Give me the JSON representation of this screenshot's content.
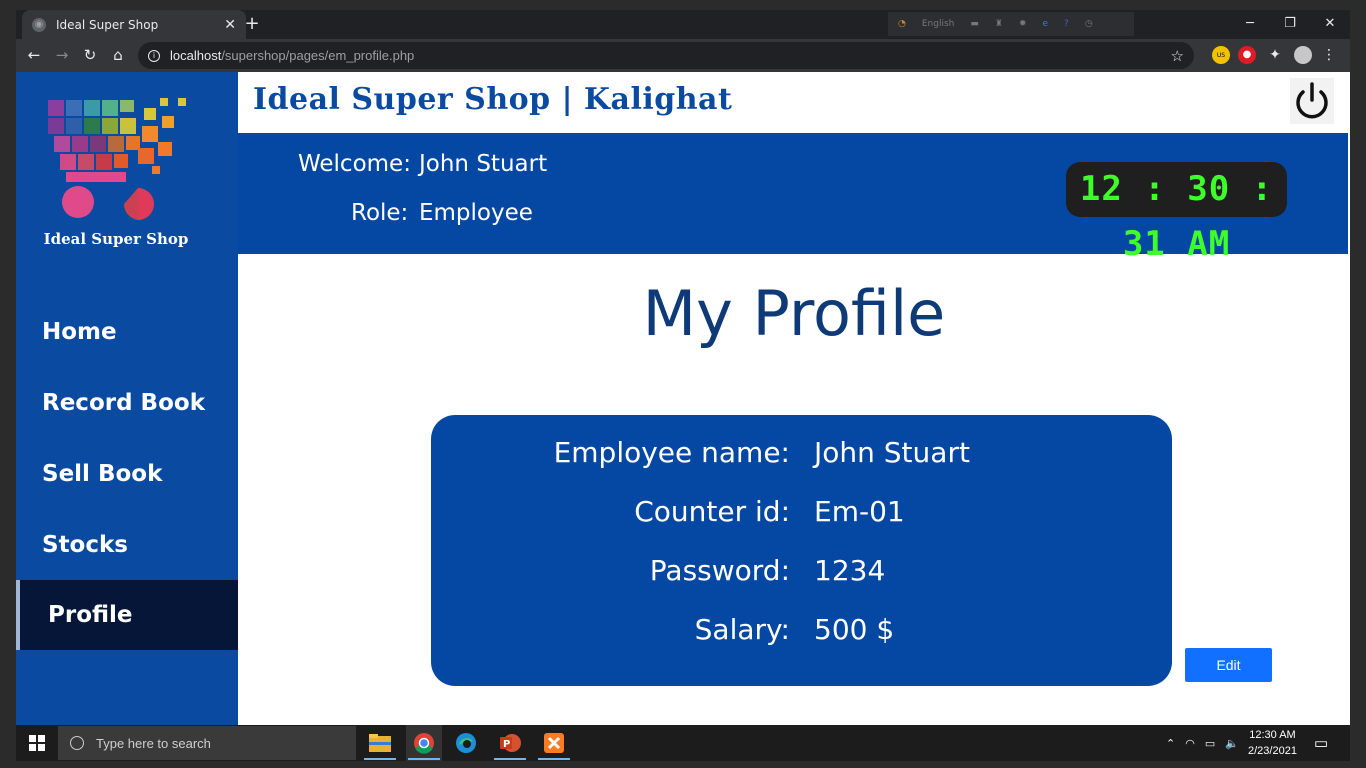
{
  "browser": {
    "tab_title": "Ideal Super Shop",
    "tab_close": "✕",
    "new_tab": "+",
    "ext_lang": "English",
    "url_host": "localhost",
    "url_path": "/supershop/pages/em_profile.php",
    "ext_badge": "US"
  },
  "sidebar": {
    "logo_text": "Ideal Super Shop",
    "items": [
      {
        "label": "Home"
      },
      {
        "label": "Record Book"
      },
      {
        "label": "Sell Book"
      },
      {
        "label": "Stocks"
      },
      {
        "label": "Profile",
        "active": true
      }
    ]
  },
  "header": {
    "shop_title": "Ideal Super Shop | Kalighat",
    "welcome_label": "Welcome:",
    "welcome_value": "John Stuart",
    "role_label": "Role:",
    "role_value": "Employee",
    "clock": "12 : 30 : 31 AM"
  },
  "main": {
    "title": "My Profile",
    "profile": [
      {
        "label": "Employee name:",
        "value": "John Stuart"
      },
      {
        "label": "Counter id:",
        "value": "Em-01"
      },
      {
        "label": "Password:",
        "value": "1234"
      },
      {
        "label": "Salary:",
        "value": "500 $"
      }
    ],
    "edit_label": "Edit"
  },
  "taskbar": {
    "search_placeholder": "Type here to search",
    "time": "12:30 AM",
    "date": "2/23/2021"
  },
  "colors": {
    "brand_blue": "#0548a3",
    "active_nav": "#061638",
    "clock_digits": "#3fff2a",
    "edit_button": "#1170ff"
  }
}
